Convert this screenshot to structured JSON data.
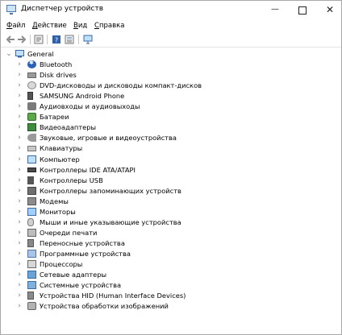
{
  "window": {
    "title": "Диспетчер устройств",
    "minimize_glyph": "—",
    "close_glyph": "✕"
  },
  "menu": {
    "file": {
      "accel": "Ф",
      "rest": "айл"
    },
    "action": {
      "accel": "Д",
      "rest": "ействие"
    },
    "view": {
      "accel": "В",
      "rest": "ид"
    },
    "help": {
      "accel": "С",
      "rest": "правка"
    }
  },
  "toolbar": {
    "icons": [
      "back-icon",
      "forward-icon",
      "properties-icon",
      "help-icon",
      "show-hidden-icon",
      "monitor-scan-icon"
    ]
  },
  "tree": {
    "root": {
      "label": "General",
      "expanded": true
    },
    "items": [
      {
        "label": "Bluetooth",
        "icon": "bluetooth-icon"
      },
      {
        "label": "Disk drives",
        "icon": "disk-drive-icon"
      },
      {
        "label": "DVD-дисководы и дисководы компакт-дисков",
        "icon": "dvd-drive-icon"
      },
      {
        "label": "SAMSUNG Android Phone",
        "icon": "phone-icon"
      },
      {
        "label": "Аудиовходы и аудиовыходы",
        "icon": "audio-io-icon"
      },
      {
        "label": "Батареи",
        "icon": "battery-icon"
      },
      {
        "label": "Видеоадаптеры",
        "icon": "video-adapter-icon"
      },
      {
        "label": "Звуковые, игровые и видеоустройства",
        "icon": "sound-icon"
      },
      {
        "label": "Клавиатуры",
        "icon": "keyboard-icon"
      },
      {
        "label": "Компьютер",
        "icon": "computer-icon"
      },
      {
        "label": "Контроллеры IDE ATA/ATAPI",
        "icon": "ide-controller-icon"
      },
      {
        "label": "Контроллеры USB",
        "icon": "usb-icon"
      },
      {
        "label": "Контроллеры запоминающих устройств",
        "icon": "storage-controller-icon"
      },
      {
        "label": "Модемы",
        "icon": "modem-icon"
      },
      {
        "label": "Мониторы",
        "icon": "monitor-icon"
      },
      {
        "label": "Мыши и иные указывающие устройства",
        "icon": "mouse-icon"
      },
      {
        "label": "Очереди печати",
        "icon": "printer-icon"
      },
      {
        "label": "Переносные устройства",
        "icon": "portable-device-icon"
      },
      {
        "label": "Программные устройства",
        "icon": "software-device-icon"
      },
      {
        "label": "Процессоры",
        "icon": "processor-icon"
      },
      {
        "label": "Сетевые адаптеры",
        "icon": "network-adapter-icon"
      },
      {
        "label": "Системные устройства",
        "icon": "system-device-icon"
      },
      {
        "label": "Устройства HID (Human Interface Devices)",
        "icon": "hid-icon"
      },
      {
        "label": "Устройства обработки изображений",
        "icon": "imaging-device-icon"
      }
    ]
  }
}
